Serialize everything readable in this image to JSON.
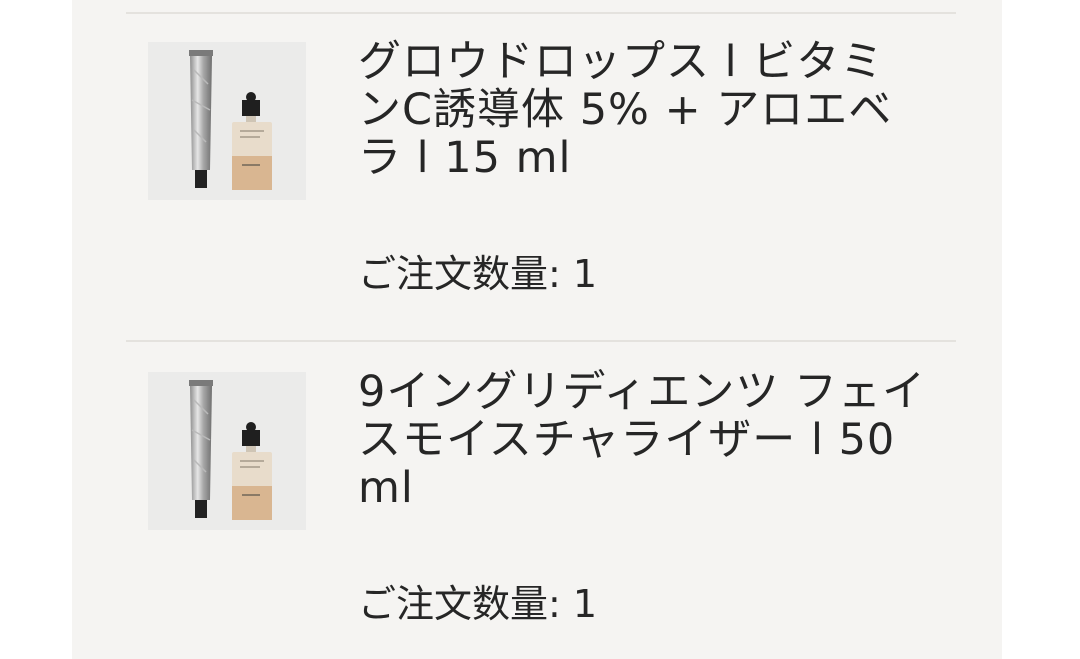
{
  "cart": {
    "items": [
      {
        "name": "グロウドロップス l ビタミンC誘導体 5% + アロエベラ l 15 ml",
        "quantity_label": "ご注文数量: 1",
        "image_icon": "product-thumbnail"
      },
      {
        "name": "9イングリディエンツ フェイスモイスチャライザー l 50 ml",
        "quantity_label": "ご注文数量: 1",
        "image_icon": "product-thumbnail"
      }
    ]
  }
}
